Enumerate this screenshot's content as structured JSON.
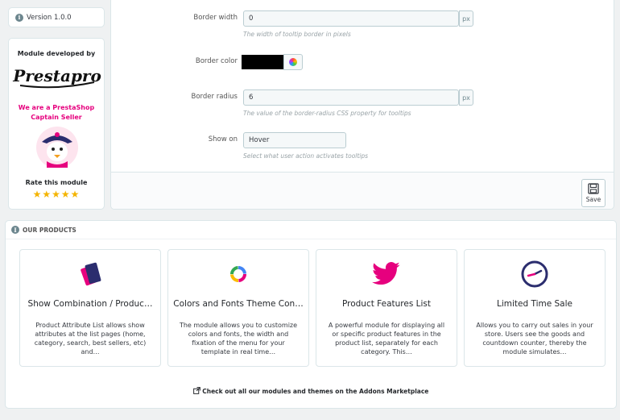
{
  "version": {
    "label": "Version 1.0.0"
  },
  "developer": {
    "title": "Module developed by",
    "logo_text": "Prestapro",
    "captain_line1": "We are a PrestaShop",
    "captain_line2": "Captain Seller",
    "rate_label": "Rate this module",
    "stars": "★★★★★"
  },
  "form": {
    "border_width": {
      "label": "Border width",
      "value": "0",
      "unit": "px",
      "help": "The width of tooltip border in pixels"
    },
    "border_color": {
      "label": "Border color",
      "value": "#000000"
    },
    "border_radius": {
      "label": "Border radius",
      "value": "6",
      "unit": "px",
      "help": "The value of the border-radius CSS property for tooltips"
    },
    "show_on": {
      "label": "Show on",
      "value": "Hover",
      "help": "Select what user action activates tooltips"
    },
    "save_label": "Save"
  },
  "products": {
    "heading": "OUR PRODUCTS",
    "cards": [
      {
        "title": "Show Combination / Produc…",
        "desc": "Product Attribute List allows show attributes at the list pages (home, category, search, best sellers, etc) and…",
        "icon": "cards-icon"
      },
      {
        "title": "Colors and Fonts Theme Con…",
        "desc": "The module allows you to customize colors and fonts, the width and fixation of the menu for your template in real time…",
        "icon": "color-ring-icon"
      },
      {
        "title": "Product Features List",
        "desc": "A powerful module for displaying all or specific product features in the product list, separately for each category. This…",
        "icon": "twitter-bird-icon"
      },
      {
        "title": "Limited Time Sale",
        "desc": "Allows you to carry out sales in your store. Users see the goods and countdown counter, thereby the module simulates…",
        "icon": "clock-icon"
      }
    ],
    "marketplace_link": "Check out all our modules and themes on the Addons Marketplace"
  },
  "colors": {
    "brand_pink": "#e6007e",
    "star": "#f4b400",
    "icon_navy": "#2b2d6e"
  }
}
